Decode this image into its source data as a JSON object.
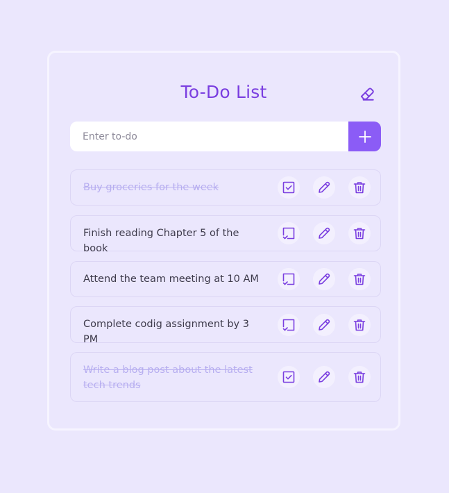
{
  "app": {
    "title": "To-Do List"
  },
  "input": {
    "placeholder": "Enter to-do",
    "value": ""
  },
  "colors": {
    "accent": "#8b5cf6",
    "title": "#7a3ee0",
    "background": "#ebe7fd",
    "done_text": "#b7aef0"
  },
  "todos": [
    {
      "text": "Buy groceries for the week",
      "done": true
    },
    {
      "text": "Finish reading Chapter 5 of the book",
      "done": false
    },
    {
      "text": "Attend the team meeting at 10 AM",
      "done": false
    },
    {
      "text": "Complete codig assignment by 3 PM",
      "done": false
    },
    {
      "text": "Write a blog post about the latest tech trends",
      "done": true
    }
  ],
  "icons": {
    "clear": "eraser-icon",
    "add": "plus-icon",
    "done": "checkbox-checked-icon",
    "pending": "checkbox-unchecked-icon",
    "edit": "pencil-icon",
    "delete": "trash-icon"
  }
}
